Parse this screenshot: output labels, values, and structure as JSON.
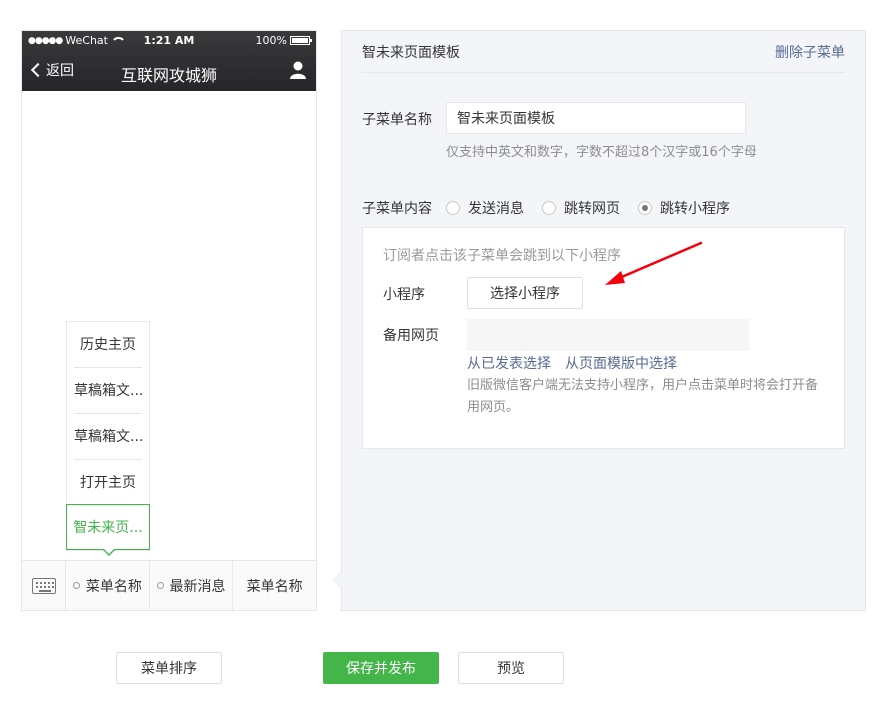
{
  "status_bar": {
    "carrier": "WeChat",
    "signal": "●●●●●",
    "time": "1:21 AM",
    "battery": "100%"
  },
  "nav": {
    "back_label": "返回",
    "title": "互联网攻城狮"
  },
  "submenu": {
    "items": [
      {
        "label": "历史主页"
      },
      {
        "label": "草稿箱文..."
      },
      {
        "label": "草稿箱文..."
      },
      {
        "label": "打开主页"
      },
      {
        "label": "智未来页..."
      }
    ],
    "active_index": 4
  },
  "menu_bar": {
    "tabs": [
      {
        "label": "菜单名称",
        "has_submenu": true
      },
      {
        "label": "最新消息",
        "has_submenu": true
      },
      {
        "label": "菜单名称",
        "has_submenu": false
      }
    ]
  },
  "editor": {
    "title": "智未来页面模板",
    "delete_label": "删除子菜单",
    "name_label": "子菜单名称",
    "name_value": "智未来页面模板",
    "name_hint": "仅支持中英文和数字，字数不超过8个汉字或16个字母",
    "content_label": "子菜单内容",
    "radio_options": [
      {
        "label": "发送消息",
        "checked": false
      },
      {
        "label": "跳转网页",
        "checked": false
      },
      {
        "label": "跳转小程序",
        "checked": true
      }
    ],
    "box": {
      "intro": "订阅者点击该子菜单会跳到以下小程序",
      "miniprogram_label": "小程序",
      "select_button": "选择小程序",
      "backup_label": "备用网页",
      "backup_value": "",
      "link_published": "从已发表选择",
      "link_template": "从页面模版中选择",
      "note": "旧版微信客户端无法支持小程序，用户点击菜单时将会打开备用网页。"
    },
    "annotation_color": "#f4000c"
  },
  "footer": {
    "sort_label": "菜单排序",
    "save_label": "保存并发布",
    "preview_label": "预览"
  },
  "colors": {
    "accent_green": "#44b549",
    "link_blue": "#576b95",
    "panel_bg": "#f4f5f9"
  }
}
